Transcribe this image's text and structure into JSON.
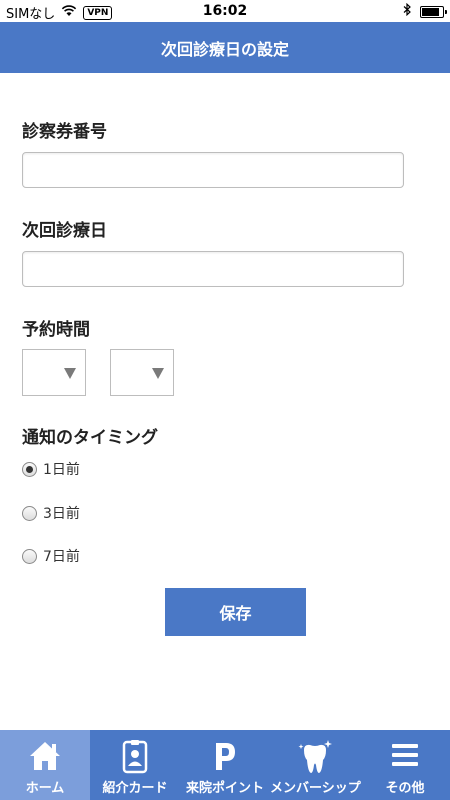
{
  "status_bar": {
    "carrier": "SIMなし",
    "vpn": "VPN",
    "time": "16:02"
  },
  "header": {
    "title": "次回診療日の設定"
  },
  "form": {
    "card_number_label": "診察券番号",
    "card_number_value": "",
    "next_date_label": "次回診療日",
    "next_date_value": "",
    "time_label": "予約時間",
    "hour_value": "",
    "minute_value": "",
    "timing_label": "通知のタイミング",
    "timing_options": [
      {
        "label": "1日前",
        "checked": true
      },
      {
        "label": "3日前",
        "checked": false
      },
      {
        "label": "7日前",
        "checked": false
      }
    ],
    "save_label": "保存"
  },
  "tabs": [
    {
      "label": "ホーム",
      "icon": "home-icon",
      "active": true
    },
    {
      "label": "紹介カード",
      "icon": "card-icon",
      "active": false
    },
    {
      "label": "来院ポイント",
      "icon": "points-icon",
      "active": false
    },
    {
      "label": "メンバーシップ",
      "icon": "tooth-icon",
      "active": false
    },
    {
      "label": "その他",
      "icon": "menu-icon",
      "active": false
    }
  ],
  "colors": {
    "primary": "#4a78c6",
    "tab_active": "#7c9edb"
  }
}
